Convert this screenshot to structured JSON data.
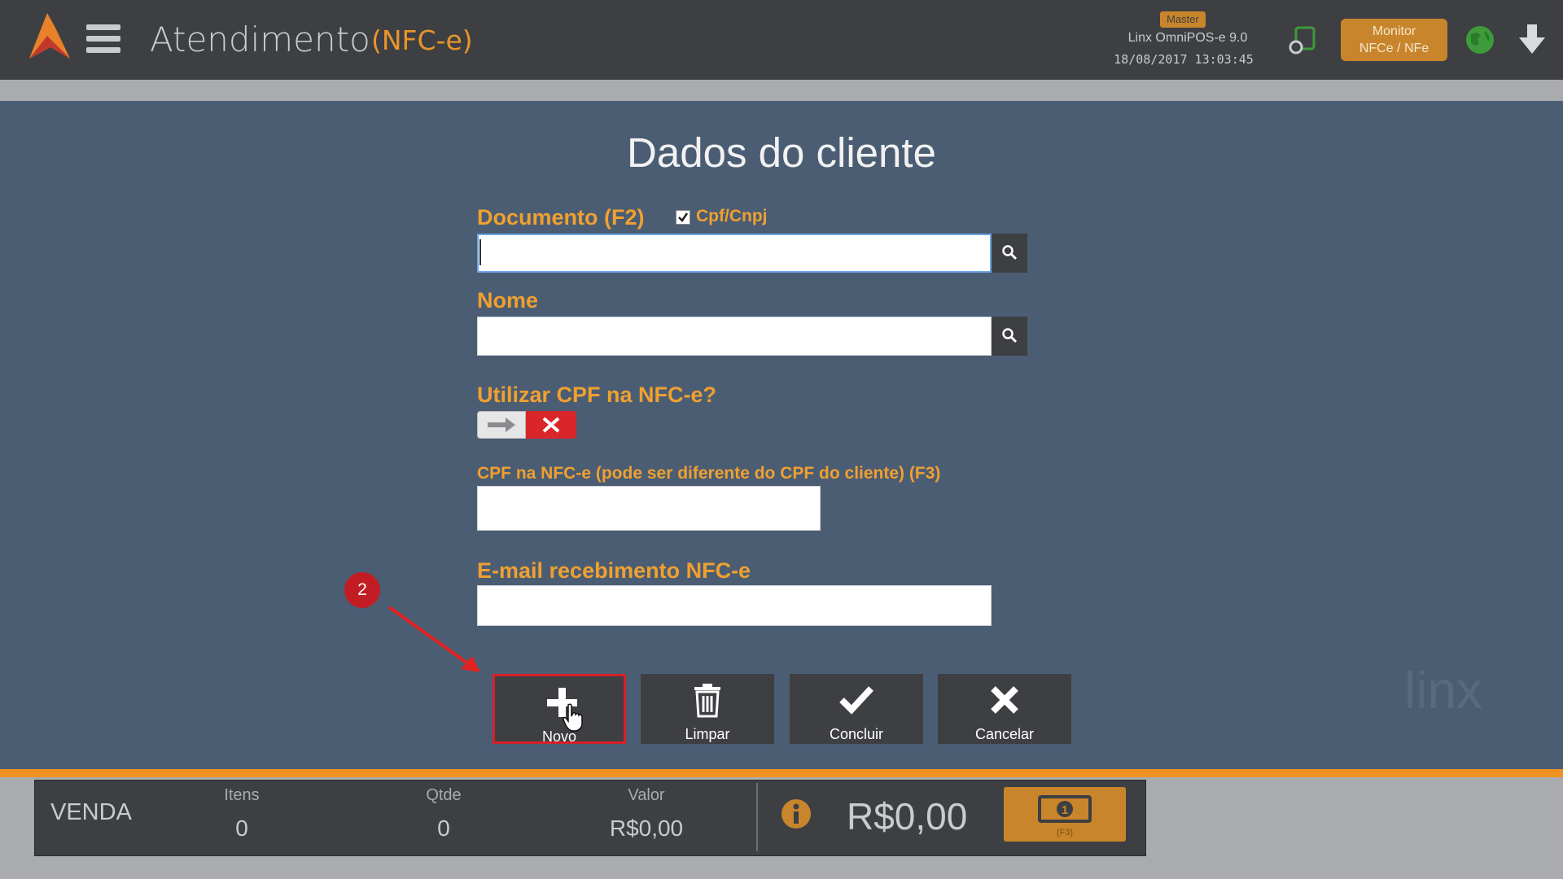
{
  "header": {
    "title": "Atendimento",
    "subtitle": "(NFC-e)",
    "badge": "Master",
    "version": "Linx OmniPOS-e  9.0",
    "datetime": "18/08/2017 13:03:45",
    "monitor_line1": "Monitor",
    "monitor_line2": "NFCe / NFe"
  },
  "dialog": {
    "title": "Dados do cliente",
    "documento_label": "Documento (F2)",
    "cpf_cnpj_label": "Cpf/Cnpj",
    "cpf_cnpj_checked": true,
    "documento_value": "",
    "nome_label": "Nome",
    "nome_value": "",
    "utilizar_cpf_label": "Utilizar CPF na NFC-e?",
    "utilizar_cpf_enabled": false,
    "cpf_nfce_label": "CPF na NFC-e (pode ser diferente do CPF do cliente) (F3)",
    "cpf_nfce_value": "",
    "email_label": "E-mail recebimento NFC-e",
    "email_value": ""
  },
  "actions": {
    "novo": "Novo",
    "limpar": "Limpar",
    "concluir": "Concluir",
    "cancelar": "Cancelar"
  },
  "annotation": {
    "step": "2"
  },
  "footer": {
    "venda": "VENDA",
    "itens_label": "Itens",
    "itens_value": "0",
    "qtde_label": "Qtde",
    "qtde_value": "0",
    "valor_label": "Valor",
    "valor_value": "R$0,00",
    "total": "R$0,00",
    "pay_shortcut": "(F3)"
  },
  "colors": {
    "accent_orange": "#f0a030",
    "danger_red": "#d9262a",
    "bar_dark": "#3d3f43",
    "background": "#4b5d73"
  }
}
